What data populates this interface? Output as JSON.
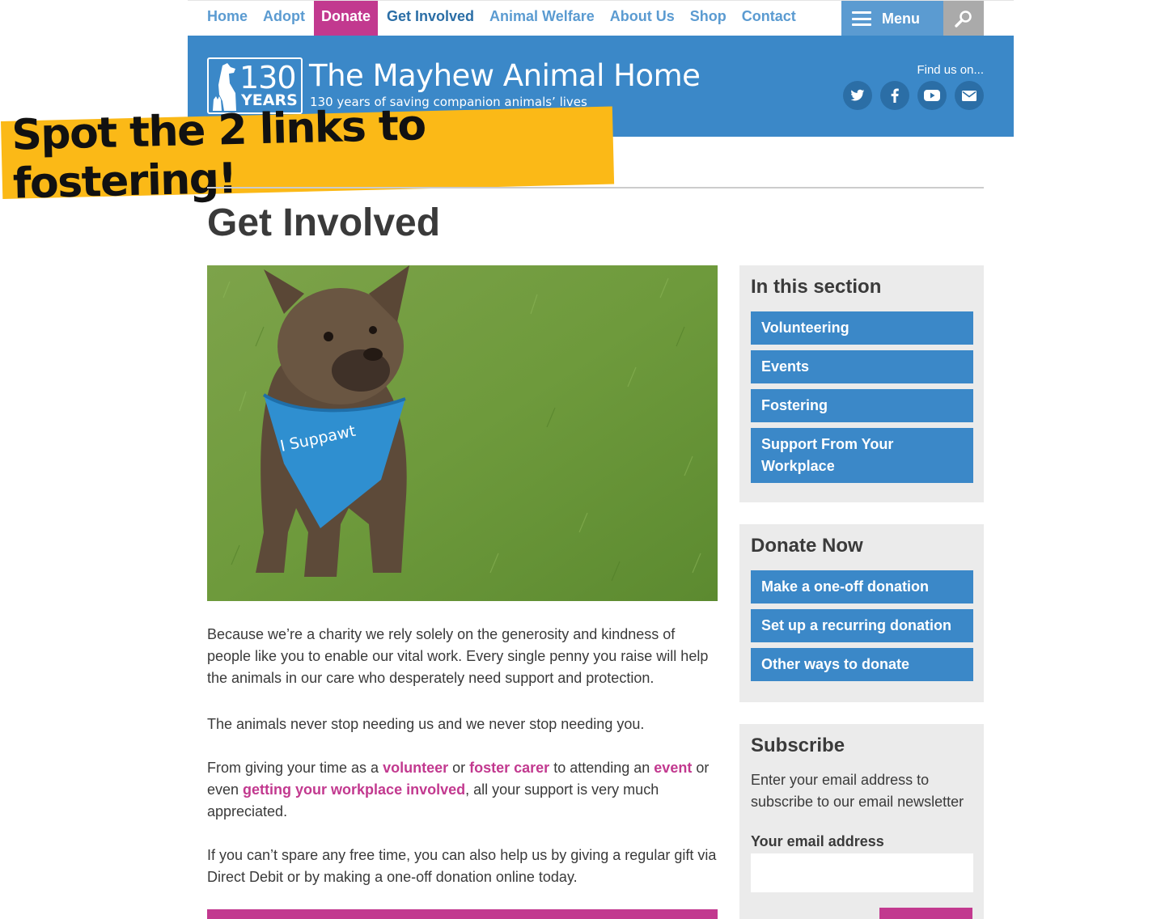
{
  "nav": {
    "links": [
      "Home",
      "Adopt",
      "Donate",
      "Get Involved",
      "Animal Welfare",
      "About Us",
      "Shop",
      "Contact"
    ],
    "menu_label": "Menu"
  },
  "header": {
    "logo_number": "130",
    "logo_years": "YEARS",
    "title": "The Mayhew Animal Home",
    "tagline": "130 years of saving companion animals’ lives",
    "find_us": "Find us on...",
    "social": [
      "twitter-icon",
      "facebook-icon",
      "youtube-icon",
      "email-icon"
    ]
  },
  "banner": {
    "text": "Spot the 2 links to fostering!"
  },
  "main": {
    "title": "Get Involved",
    "para1": "Because we’re a charity we rely solely on the generosity and kindness of people like you to enable our vital work. Every single penny you raise will help the animals in our care who desperately need support and protection.",
    "para2": "The animals never stop needing us and we never stop needing you.",
    "para3": {
      "t1": "From giving your time as a ",
      "link_volunteer": "volunteer",
      "t2": " or ",
      "link_foster": "foster carer",
      "t3": " to attending an ",
      "link_event": "event",
      "t4": " or even ",
      "link_workplace": "getting your workplace involved",
      "t5": ", all your support is very much appreciated."
    },
    "para4": "If you can’t spare any free time, you can also help us by giving a regular gift via Direct Debit or by making a one-off donation online today.",
    "bandana_text": "I Suppawt"
  },
  "sidebar": {
    "section": {
      "title": "In this section",
      "links": [
        "Volunteering",
        "Events",
        "Fostering",
        "Support From Your Workplace"
      ]
    },
    "donate": {
      "title": "Donate Now",
      "links": [
        "Make a one-off donation",
        "Set up a recurring donation",
        "Other ways to donate"
      ]
    },
    "subscribe": {
      "title": "Subscribe",
      "description": "Enter your email address to subscribe to our email newsletter",
      "email_label": "Your email address",
      "email_value": ""
    }
  },
  "colors": {
    "brand_blue": "#3b88c8",
    "nav_blue": "#5b9bd1",
    "accent_pink": "#c2398f",
    "banner_yellow": "#fbb917"
  }
}
